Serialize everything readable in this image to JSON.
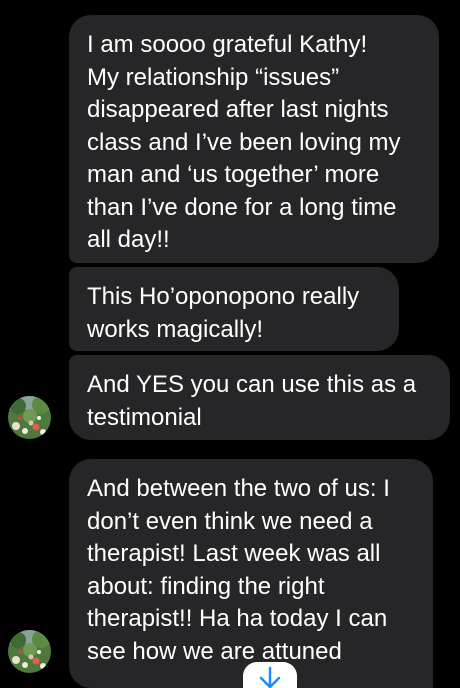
{
  "messages": [
    {
      "lines": [
        "I am soooo grateful Kathy!",
        "My relationship “issues”",
        "disappeared after last nights",
        "class and I’ve been loving my",
        "man and ‘us together’ more",
        "than I’ve done for a long time",
        "all day!!"
      ]
    },
    {
      "lines": [
        "This Ho’oponopono really",
        "works magically!"
      ]
    },
    {
      "lines": [
        "And YES you can use this as a",
        "testimonial"
      ]
    },
    {
      "lines": [
        "And between the two of us: I",
        "don’t even think we need a",
        "therapist! Last week was all",
        "about: finding the right",
        "therapist!! Ha ha today I can",
        "see how we are attuned"
      ]
    }
  ],
  "sender": {
    "avatar_icon": "garden-flowers-avatar"
  },
  "scroll_button": {
    "icon": "arrow-down-icon",
    "color": "#1a8cff"
  },
  "colors": {
    "background": "#000000",
    "bubble": "#262628",
    "text": "#ffffff"
  }
}
